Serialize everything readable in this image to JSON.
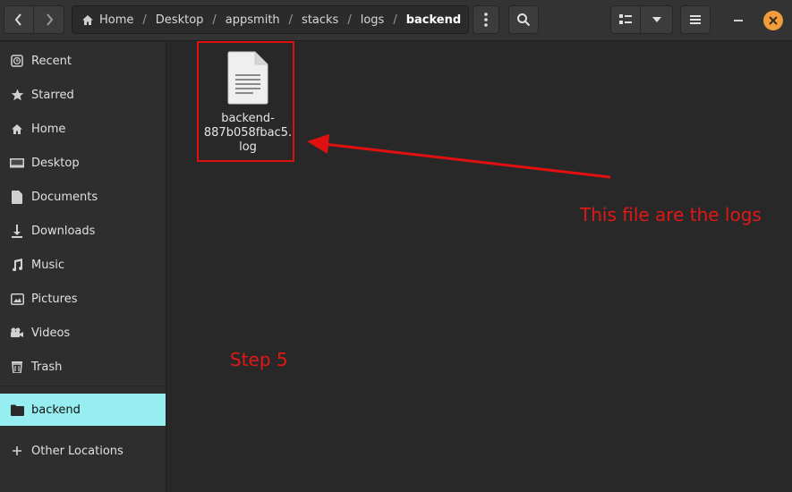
{
  "breadcrumb": {
    "items": [
      "Home",
      "Desktop",
      "appsmith",
      "stacks",
      "logs",
      "backend"
    ]
  },
  "sidebar": {
    "items": [
      {
        "label": "Recent",
        "icon": "clock-icon"
      },
      {
        "label": "Starred",
        "icon": "star-icon"
      },
      {
        "label": "Home",
        "icon": "home-icon"
      },
      {
        "label": "Desktop",
        "icon": "desktop-icon"
      },
      {
        "label": "Documents",
        "icon": "document-icon"
      },
      {
        "label": "Downloads",
        "icon": "download-icon"
      },
      {
        "label": "Music",
        "icon": "music-icon"
      },
      {
        "label": "Pictures",
        "icon": "pictures-icon"
      },
      {
        "label": "Videos",
        "icon": "video-icon"
      },
      {
        "label": "Trash",
        "icon": "trash-icon"
      },
      {
        "label": "backend",
        "icon": "folder-icon"
      },
      {
        "label": "Other Locations",
        "icon": "plus-icon"
      }
    ],
    "active": "backend"
  },
  "files": [
    {
      "name": "backend-887b058fbac5.log",
      "name_line1": "backend-",
      "name_line2": "887b058fbac5.",
      "name_line3": "log",
      "icon": "text-file-icon"
    }
  ],
  "annotations": {
    "arrow_label": "This file are the logs",
    "step_label": "Step 5",
    "color": "#e01010"
  },
  "colors": {
    "accent": "#96eef0",
    "close_button": "#f39c3c",
    "background": "#282828"
  }
}
